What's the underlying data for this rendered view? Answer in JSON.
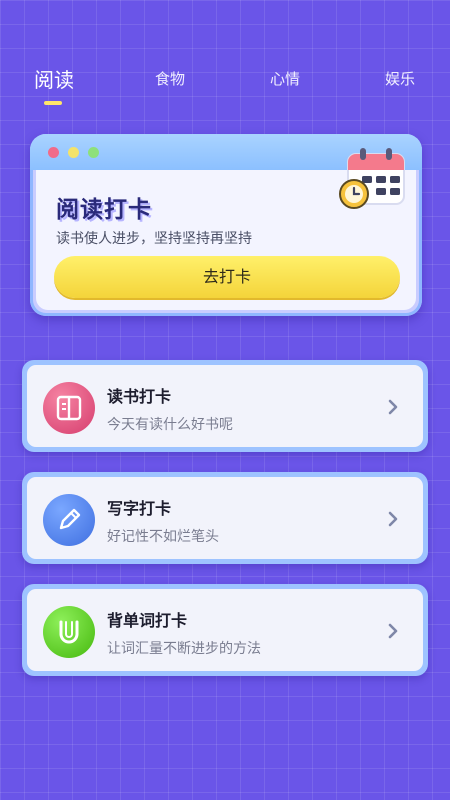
{
  "tabs": [
    {
      "label": "阅读",
      "active": true
    },
    {
      "label": "食物",
      "active": false
    },
    {
      "label": "心情",
      "active": false
    },
    {
      "label": "娱乐",
      "active": false
    }
  ],
  "hero": {
    "title": "阅读打卡",
    "subtitle": "读书使人进步，坚持坚持再坚持",
    "button_label": "去打卡",
    "calendar_icon": "calendar-clock-icon"
  },
  "items": [
    {
      "title": "读书打卡",
      "description": "今天有读什么好书呢",
      "icon": "book-icon",
      "icon_color": "#e85886"
    },
    {
      "title": "写字打卡",
      "description": "好记性不如烂笔头",
      "icon": "pencil-icon",
      "icon_color": "#4f7ef0"
    },
    {
      "title": "背单词打卡",
      "description": "让词汇量不断进步的方法",
      "icon": "letter-u-icon",
      "icon_color": "#5ed01e"
    }
  ],
  "colors": {
    "background": "#6a55e8",
    "accent_yellow": "#f4d43a",
    "card_border": "#9ec3ff"
  }
}
